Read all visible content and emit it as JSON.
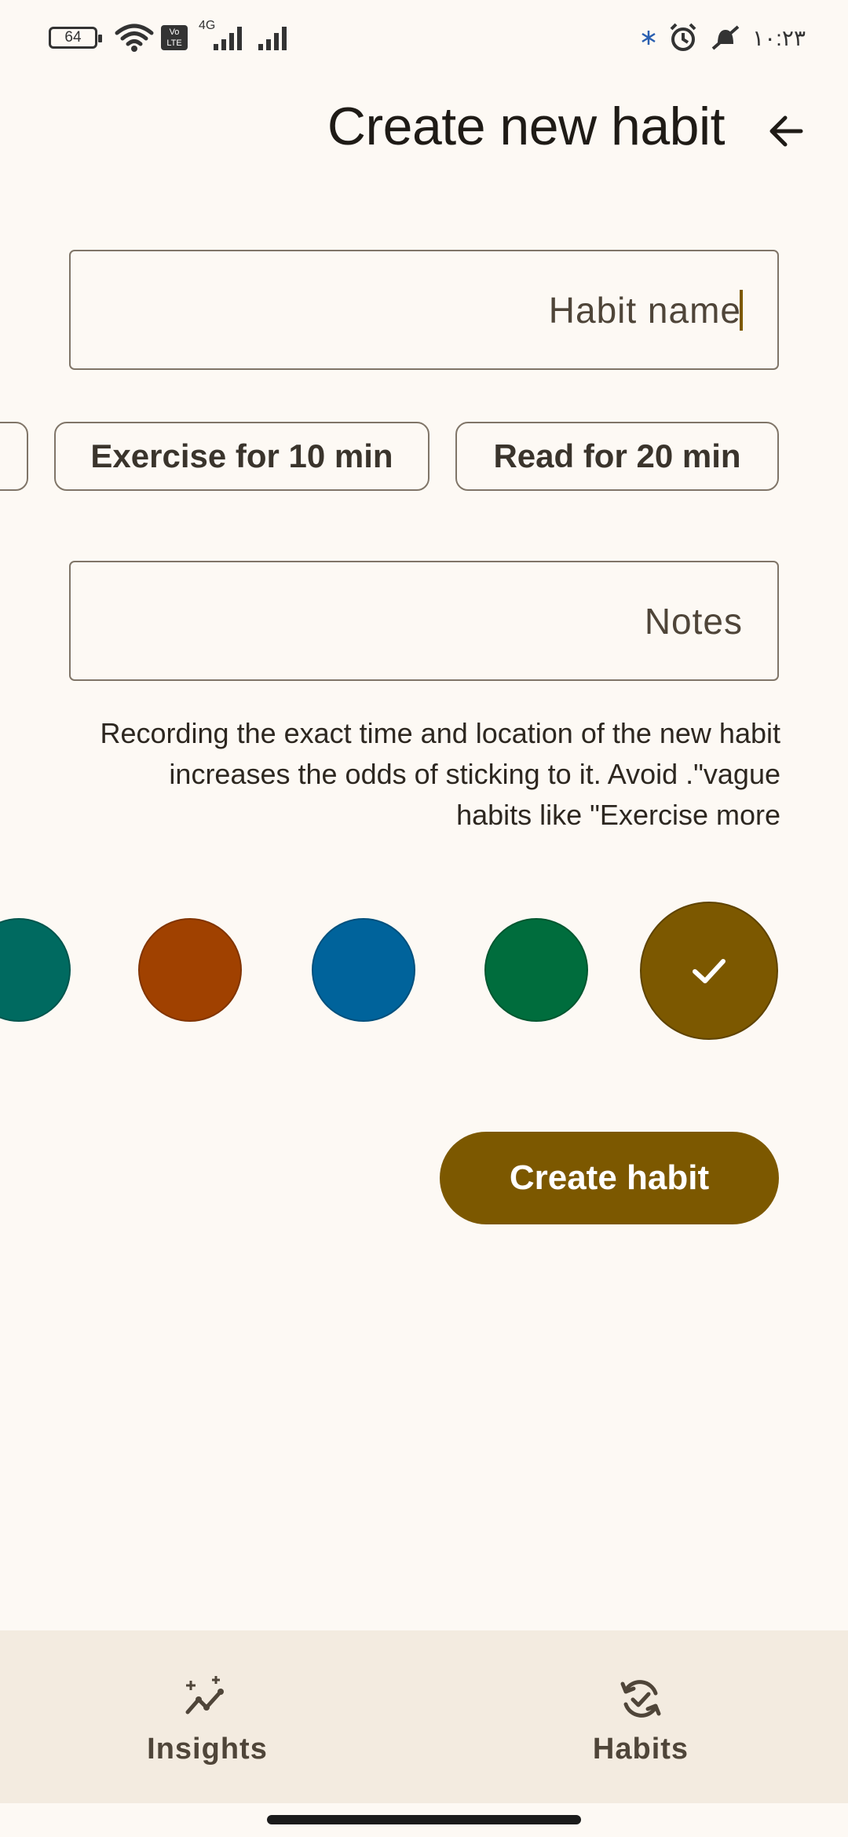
{
  "status_bar": {
    "battery": "64",
    "network": "4G",
    "volte": "Vo LTE",
    "clock": "۱۰:۲۳"
  },
  "header": {
    "title": "Create new habit",
    "back_icon": "arrow-left-icon"
  },
  "habit_name": {
    "placeholder": "Habit name",
    "value": ""
  },
  "suggestions": [
    {
      "label": "Exercise for 10 min"
    },
    {
      "label": "Read for 20 min"
    }
  ],
  "notes": {
    "placeholder": "Notes",
    "value": ""
  },
  "help_text": "Recording the exact time and location of the new habit increases the odds of sticking to it. Avoid .\"vague habits like \"Exercise more",
  "colors": {
    "options": [
      "#006a60",
      "#a04100",
      "#00639b",
      "#006d3d",
      "#7c5800"
    ],
    "selected": "#7c5800"
  },
  "actions": {
    "create_label": "Create habit"
  },
  "bottom_nav": {
    "items": [
      {
        "label": "Insights",
        "icon": "insights-sparkle-icon"
      },
      {
        "label": "Habits",
        "icon": "habits-check-cycle-icon"
      }
    ]
  }
}
